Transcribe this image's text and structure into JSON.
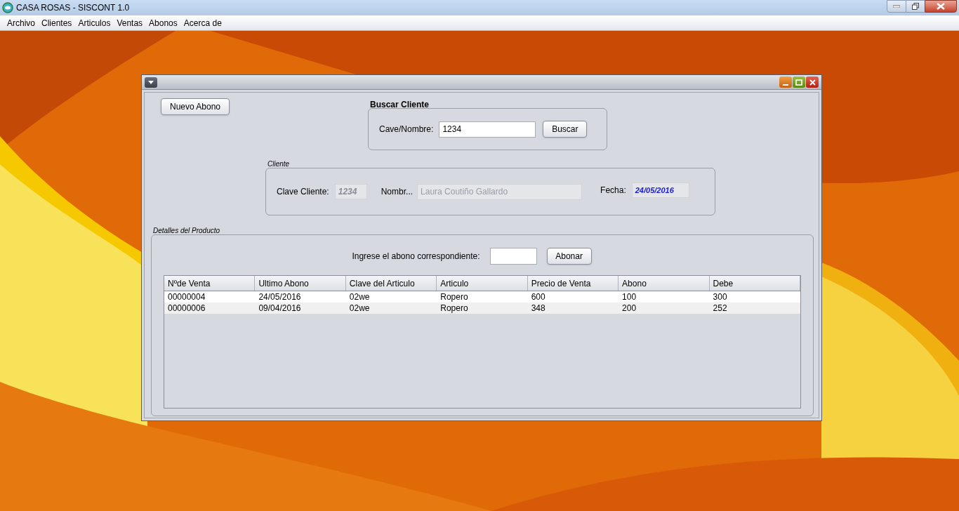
{
  "app_title": "CASA ROSAS - SISCONT 1.0",
  "menu": [
    "Archivo",
    "Clientes",
    "Articulos",
    "Ventas",
    "Abonos",
    "Acerca de"
  ],
  "frame": {
    "new_button": "Nuevo Abono",
    "search": {
      "title": "Buscar Cliente",
      "label": "Cave/Nombre:",
      "value": "1234",
      "button": "Buscar"
    },
    "client": {
      "title": "Cliente",
      "key_label": "Clave Cliente:",
      "key_value": "1234",
      "name_label": "Nombr...",
      "name_value": "Laura Coutiño Gallardo",
      "date_label": "Fecha:",
      "date_value": "24/05/2016"
    },
    "details": {
      "title": "Detalles del Producto",
      "payment_label": "Ingrese el abono correspondiente:",
      "payment_button": "Abonar",
      "table": {
        "columns": [
          "Nºde Venta",
          "Ultimo Abono",
          "Clave del Articulo",
          "Articulo",
          "Precio de Venta",
          "Abono",
          "Debe"
        ],
        "rows": [
          [
            "00000004",
            "24/05/2016",
            "02we",
            "Ropero",
            "600",
            "100",
            "300"
          ],
          [
            "00000006",
            "09/04/2016",
            "02we",
            "Ropero",
            "348",
            "200",
            "252"
          ]
        ]
      }
    }
  }
}
